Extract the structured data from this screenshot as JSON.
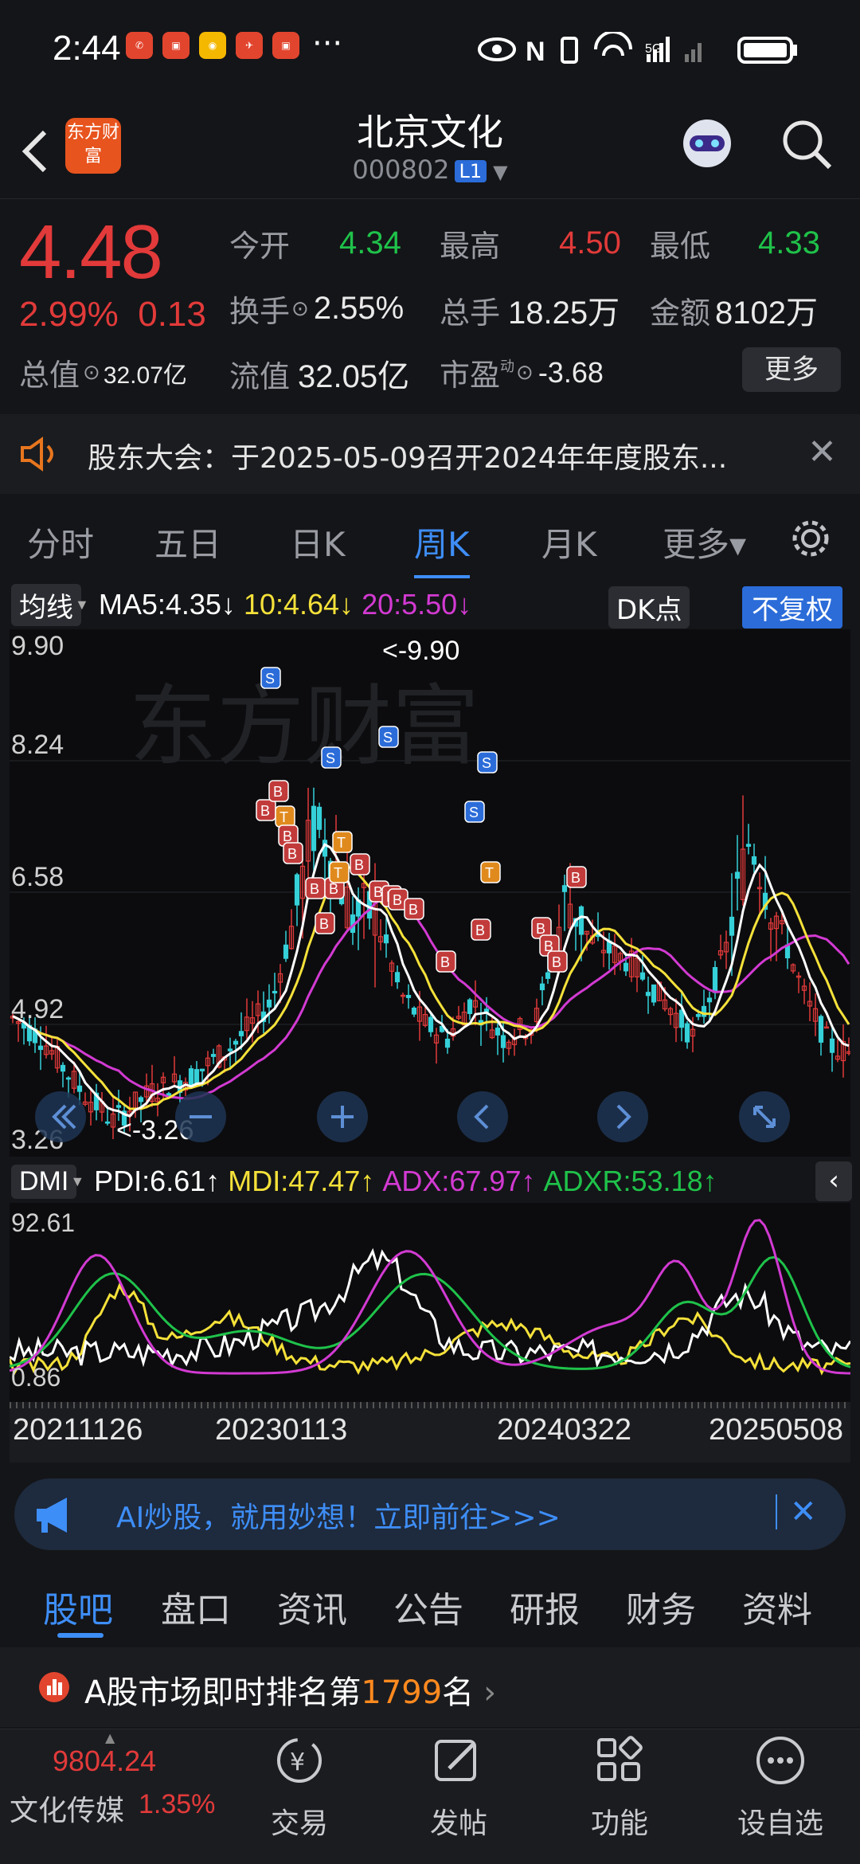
{
  "status_bar": {
    "time": "2:44",
    "dots": "···"
  },
  "header": {
    "title": "北京文化",
    "code": "000802",
    "market_badge": "L1",
    "logo_text": "东方财富"
  },
  "quote": {
    "price": "4.48",
    "pct": "2.99%",
    "change": "0.13",
    "open_label": "今开",
    "open": "4.34",
    "high_label": "最高",
    "high": "4.50",
    "low_label": "最低",
    "low": "4.33",
    "turnover_label": "换手",
    "turnover": "2.55%",
    "volume_label": "总手",
    "volume": "18.25万",
    "amount_label": "金额",
    "amount": "8102万",
    "mktcap_label": "总值",
    "mktcap": "32.07亿",
    "float_label": "流值",
    "float": "32.05亿",
    "pe_label": "市盈",
    "pe_sup": "动",
    "pe": "-3.68",
    "more_label": "更多"
  },
  "notice": {
    "text": "股东大会：于2025-05-09召开2024年年度股东..."
  },
  "period_tabs": [
    "分时",
    "五日",
    "日K",
    "周K",
    "月K",
    "更多▾"
  ],
  "active_period": "周K",
  "ma_legend": {
    "selector": "均线",
    "ma5": "MA5:4.35↓",
    "ma10": "10:4.64↓",
    "ma20": "20:5.50↓",
    "dk": "DK点",
    "adj": "不复权"
  },
  "kchart_axis": {
    "y_labels": [
      "9.90",
      "8.24",
      "6.58",
      "4.92",
      "3.26"
    ],
    "max_note": "<-9.90",
    "min_note": "<-3.26"
  },
  "dmi_legend": {
    "selector": "DMI",
    "pdi": "PDI:6.61↑",
    "mdi": "MDI:47.47↑",
    "adx": "ADX:67.97↑",
    "adxr": "ADXR:53.18↑"
  },
  "dmi_axis": {
    "y_labels": [
      "92.61",
      "0.86"
    ]
  },
  "dates": [
    "20211126",
    "20230113",
    "20240322",
    "20250508"
  ],
  "ai_banner": {
    "text": "AI炒股，就用妙想！立即前往>>>"
  },
  "content_tabs": [
    "股吧",
    "盘口",
    "资讯",
    "公告",
    "研报",
    "财务",
    "资料"
  ],
  "active_content_tab": "股吧",
  "rank": {
    "prefix": "A股市场即时排名第",
    "number": "1799",
    "suffix": "名"
  },
  "bottom_nav": {
    "index_value": "9804.24",
    "index_name": "文化传媒",
    "index_pct": "1.35%",
    "trade": "交易",
    "post": "发帖",
    "function": "功能",
    "watch": "设自选"
  },
  "colors": {
    "up": "#e23a3a",
    "down": "#1fc24a",
    "accent": "#3e8ef7",
    "ma5": "#ffffff",
    "ma10": "#f5e13a",
    "ma20": "#d23ad2"
  }
}
